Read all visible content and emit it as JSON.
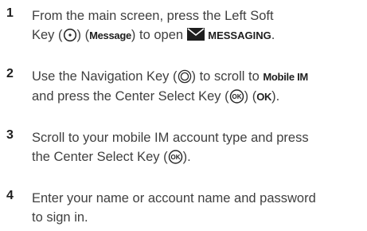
{
  "steps": [
    {
      "number": "1",
      "line1": "From the main screen, press the Left Soft",
      "line2_a": "Key (",
      "line2_b": ") (",
      "line2_c": "Message",
      "line2_d": ") to open",
      "line2_e": "MESSAGING",
      "line2_f": "."
    },
    {
      "number": "2",
      "line1_a": "Use the Navigation Key (",
      "line1_b": ") to scroll to",
      "line1_c": "Mobile IM",
      "line2_a": "and press the Center Select Key (",
      "line2_b": ") (",
      "line2_c": "OK",
      "line2_d": ")."
    },
    {
      "number": "3",
      "line1": "Scroll to your mobile IM account type and press",
      "line2_a": "the Center Select Key (",
      "line2_b": ")."
    },
    {
      "number": "4",
      "line1": "Enter your name or account name and password",
      "line2": "to sign in."
    }
  ],
  "icons": {
    "soft_key": "left-soft-key-icon",
    "envelope": "envelope-icon",
    "nav_key": "navigation-key-icon",
    "ok_key": "center-select-key-icon",
    "ok_key_glyph": "OK"
  }
}
